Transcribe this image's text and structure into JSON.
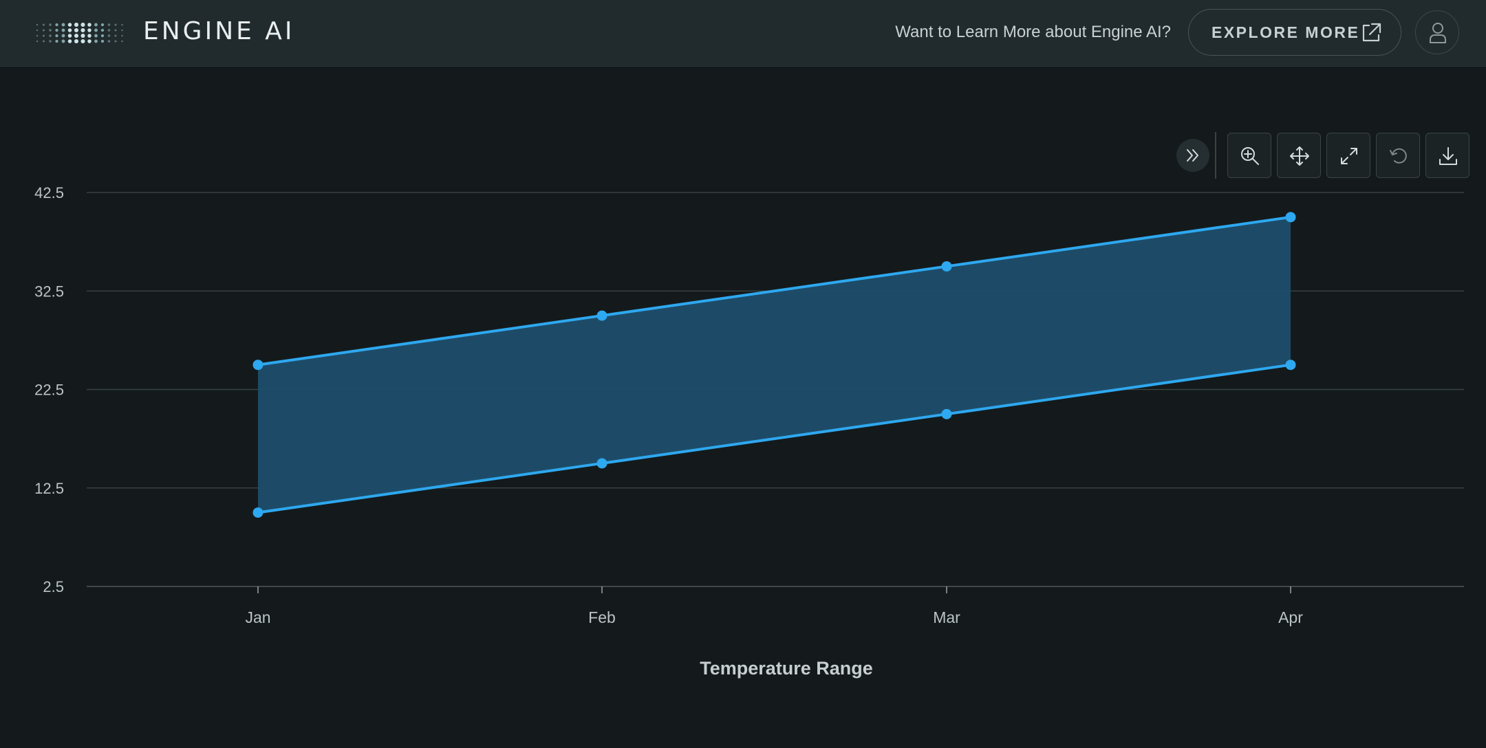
{
  "header": {
    "brand": "ENGINE AI",
    "promo_text": "Want to Learn More about Engine AI?",
    "explore_label": "EXPLORE MORE"
  },
  "toolbar": {
    "icons": [
      "collapse-icon",
      "zoom-in-icon",
      "pan-icon",
      "expand-icon",
      "reset-icon",
      "download-icon"
    ]
  },
  "colors": {
    "accent": "#2ea8f0",
    "band_fill": "#1d4e6b",
    "background": "#141a1b",
    "header_bg": "#212a2c",
    "grid": "#3e4849"
  },
  "chart_data": {
    "type": "area",
    "subtype": "range-band",
    "categories": [
      "Jan",
      "Feb",
      "Mar",
      "Apr"
    ],
    "series": [
      {
        "name": "",
        "values": [
          10,
          15,
          20,
          25
        ]
      },
      {
        "name": "",
        "values": [
          25,
          30,
          35,
          40
        ]
      }
    ],
    "ylim": [
      2.5,
      42.5
    ],
    "yticks": [
      "2.5",
      "12.5",
      "22.5",
      "32.5",
      "42.5"
    ],
    "xlabel": "Temperature Range",
    "ylabel": "",
    "title": "",
    "grid": true,
    "legend": "none"
  }
}
